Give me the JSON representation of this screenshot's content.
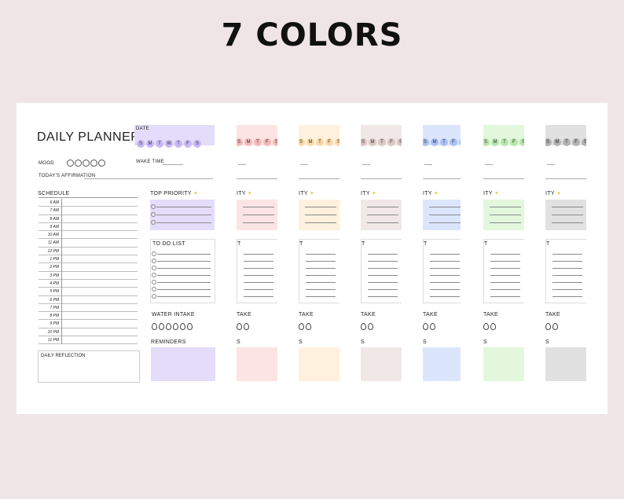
{
  "headline": "7 COLORS",
  "planner": {
    "title": "DAILY PLANNER",
    "mood_label": "MOOD",
    "affirmation_label": "TODAY'S AFFIRMATION",
    "schedule_label": "SCHEDULE",
    "schedule_times": [
      "6 AM",
      "7 AM",
      "8 AM",
      "9 AM",
      "10 AM",
      "11 AM",
      "12 PM",
      "1 PM",
      "2 PM",
      "3 PM",
      "4 PM",
      "5 PM",
      "6 PM",
      "7 PM",
      "8 PM",
      "9 PM",
      "10 PM",
      "11 PM"
    ],
    "reflection_label": "DAILY REFLECTION",
    "date_label": "DATE",
    "days": [
      "S",
      "M",
      "T",
      "W",
      "T",
      "F",
      "S"
    ],
    "wake_label": "WAKE TIME",
    "priority_label": "TOP PRIORITY",
    "todo_label": "TO DO LIST",
    "water_label": "WATER INTAKE",
    "reminders_label": "REMINDERS"
  },
  "colors": [
    "#e4dcfb",
    "#fde4e4",
    "#fff1de",
    "#f1e7e7",
    "#dbe6fd",
    "#e2f7dc",
    "#e1e1e1"
  ],
  "dot_colors": [
    "#c7b9f5",
    "#f5b9b9",
    "#fbd9a6",
    "#dcc6c6",
    "#a8c1f5",
    "#b8e6ab",
    "#b3b3b3"
  ],
  "partial": {
    "days": [
      "S",
      "M",
      "T",
      "F",
      "S"
    ],
    "priority": "ITY",
    "todo": "T",
    "water": "TAKE",
    "reminders": "S"
  }
}
